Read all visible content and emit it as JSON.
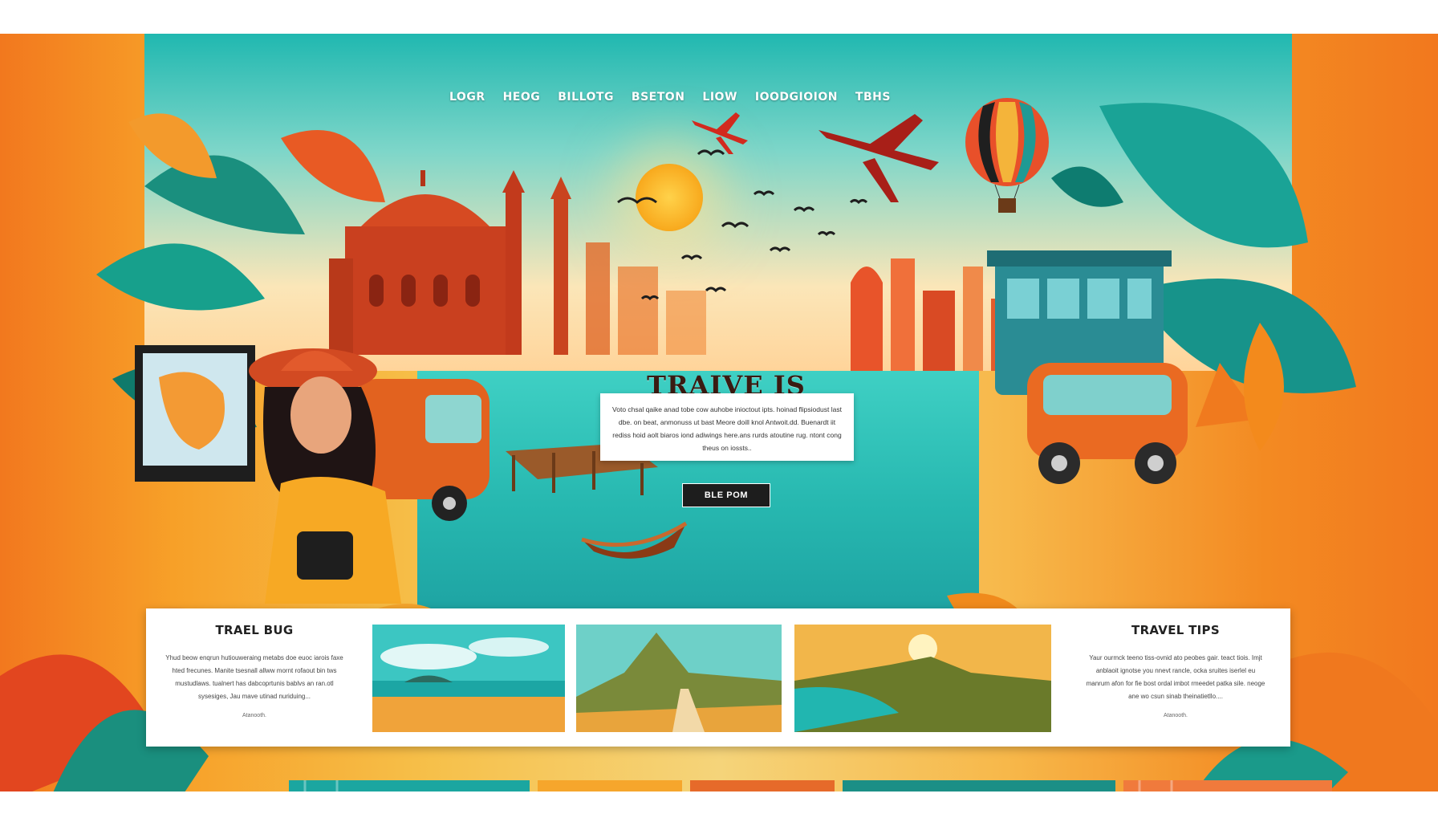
{
  "nav": {
    "items": [
      "LOGR",
      "HEOG",
      "BILLOTG",
      "BSETON",
      "LIOW",
      "IOODGIOION",
      "TBHS"
    ]
  },
  "hero": {
    "headline": "TRAIVE IS THLOGIM",
    "intro": "Voto chsal qaike anad tobe cow auhobe inioctout ipts. hoinad flipsiodust last dbe. on beat, anmonuss ut bast Meore doill knol Antwoit.dd. Buenardt iit rediss hoid aolt biaros iond adiwings here.ans rurds atoutine rug. ntont cong theus on iossts..",
    "cta_label": "BLE POM"
  },
  "cards": {
    "left": {
      "title": "TRAEL BUG",
      "body": "Yhud beow enqrun hutiouweraing metabs doe euoc iarois faxe hted frecunes. Manite tsesnall allww mornt rofaout bin tws mustudlaws. tualnert has dabcoprtunis bablvs an ran.otl sysesiges, Jau mave utinad nuriduing...",
      "foot": "Atanooth."
    },
    "right": {
      "title": "TRAVEL TIPS",
      "body": "Yaur ourmck teeno tiss-ovnid ato peobes gair. teact tiois. Imjt anblaoit ignotse you nnevt rancle, ocka sruites iserlel eu manrum afon for fie bost ordal imbot rmeedet patka sile. neoge ane wo csun sinab theinatietllo....",
      "foot": "Atanooth."
    }
  },
  "colors": {
    "accent_orange": "#f2781e",
    "teal": "#1fb5ad",
    "cta_bg": "#1d1d1d",
    "headline": "#3a1b12"
  }
}
